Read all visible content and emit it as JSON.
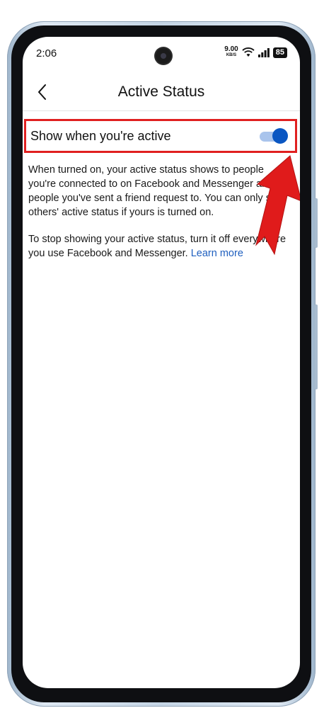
{
  "status_bar": {
    "time": "2:06",
    "net_speed_value": "9.00",
    "net_speed_unit": "KB/S",
    "battery": "85"
  },
  "header": {
    "title": "Active Status"
  },
  "setting": {
    "label": "Show when you're active",
    "enabled": true
  },
  "description": {
    "paragraph1": "When turned on, your active status shows to people you're connected to on Facebook and Messenger and to people you've sent a friend request to. You can only see others' active status if yours is turned on.",
    "paragraph2_text": "To stop showing your active status, turn it off everywhere you use Facebook and Messenger. ",
    "learn_more": "Learn more"
  },
  "colors": {
    "highlight_border": "#e02020",
    "toggle_on": "#0a56c2",
    "link": "#1f5fbf",
    "arrow": "#e01b1b"
  },
  "icons": {
    "back": "back-arrow-icon",
    "wifi": "wifi-icon",
    "signal": "signal-icon"
  }
}
